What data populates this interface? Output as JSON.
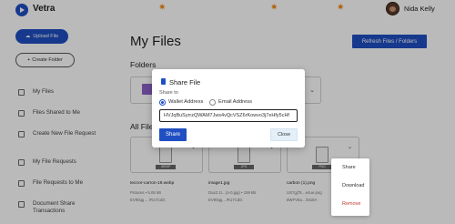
{
  "app": {
    "brand": "Vetra",
    "user_name": "Nida Kelly"
  },
  "sidebar": {
    "upload_label": "Upload File",
    "create_folder_label": "Create Folder",
    "items": [
      {
        "label": "My Files"
      },
      {
        "label": "Files Shared to Me"
      },
      {
        "label": "Create New File Request"
      },
      {
        "label": "My File Requests"
      },
      {
        "label": "File Requests to Me"
      },
      {
        "label": "Document Share Transactions"
      }
    ]
  },
  "main": {
    "title": "My Files",
    "refresh_label": "Refresh Files / Folders",
    "folders_label": "Folders",
    "files_label": "All Files",
    "files": [
      {
        "name": "tecnor-carron-19.webp",
        "type": "WEBP",
        "meta1": "Pictures • 5.06 kB",
        "meta2": "EV90qg… /R17CdG"
      },
      {
        "name": "image1.jpg",
        "type": "JPG",
        "meta1": "Dux2.1t…(s-0.jpg) • 159 kB",
        "meta2": "EV90qg…/R17CdG"
      },
      {
        "name": "carbon (1).png",
        "type": "PNG",
        "meta1": "US7gj75…e4ue.png",
        "meta2": "8WFV5a…/5I18A"
      }
    ]
  },
  "context_menu": {
    "share": "Share",
    "download": "Download",
    "remove": "Remove"
  },
  "modal": {
    "title": "Share File",
    "share_to_label": "Share to",
    "option_wallet": "Wallet Address",
    "option_email": "Email Address",
    "address_value": "HVJqBuSyrrzQWAM7Jws4vQcVSZ6rKowvo3j7eHfy5cHf",
    "share_label": "Share",
    "close_label": "Close"
  },
  "colors": {
    "accent": "#1f4fc2",
    "folder": "#8b60c7",
    "remove": "#c0392b"
  }
}
